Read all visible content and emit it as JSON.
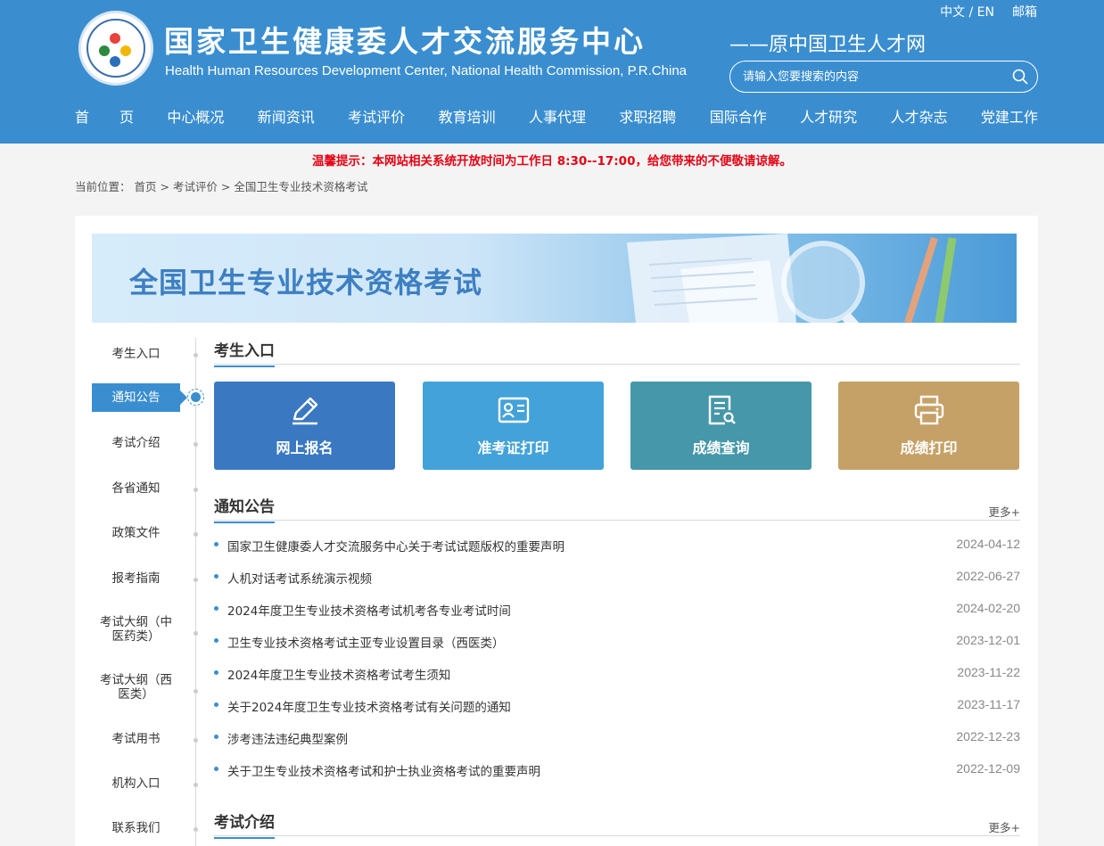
{
  "header": {
    "title": "国家卫生健康委人才交流服务中心",
    "subtitle": "Health Human Resources Development Center, National Health Commission, P.R.China",
    "slogan": "——原中国卫生人才网",
    "lang": "中文 / EN",
    "mail": "邮箱",
    "search_placeholder": "请输入您要搜索的内容"
  },
  "nav": [
    "首页",
    "中心概况",
    "新闻资讯",
    "考试评价",
    "教育培训",
    "人事代理",
    "求职招聘",
    "国际合作",
    "人才研究",
    "人才杂志",
    "党建工作"
  ],
  "notice": "温馨提示：本网站相关系统开放时间为工作日 8:30--17:00，给您带来的不便敬请谅解。",
  "breadcrumb": {
    "label": "当前位置：",
    "home": "首页",
    "sep1": " > ",
    "section": "考试评价",
    "sep2": " > ",
    "current": "全国卫生专业技术资格考试"
  },
  "banner": {
    "title": "全国卫生专业技术资格考试"
  },
  "sidebar": [
    "考生入口",
    "通知公告",
    "考试介绍",
    "各省通知",
    "政策文件",
    "报考指南",
    "考试大纲（中医药类）",
    "考试大纲（西医类）",
    "考试用书",
    "机构入口",
    "联系我们"
  ],
  "sections": {
    "entry": "考生入口",
    "notices": "通知公告",
    "intro": "考试介绍",
    "more": "更多+"
  },
  "tiles": [
    {
      "label": "网上报名",
      "icon": "pen-icon",
      "color": "#3a78c1"
    },
    {
      "label": "准考证打印",
      "icon": "id-card-icon",
      "color": "#43a2d9"
    },
    {
      "label": "成绩查询",
      "icon": "document-search-icon",
      "color": "#4597a9"
    },
    {
      "label": "成绩打印",
      "icon": "printer-icon",
      "color": "#c6a167"
    }
  ],
  "news": [
    {
      "title": "国家卫生健康委人才交流服务中心关于考试试题版权的重要声明",
      "date": "2024-04-12"
    },
    {
      "title": "人机对话考试系统演示视频",
      "date": "2022-06-27"
    },
    {
      "title": "2024年度卫生专业技术资格考试机考各专业考试时间",
      "date": "2024-02-20"
    },
    {
      "title": "卫生专业技术资格考试主亚专业设置目录（西医类）",
      "date": "2023-12-01"
    },
    {
      "title": "2024年度卫生专业技术资格考试考生须知",
      "date": "2023-11-22"
    },
    {
      "title": "关于2024年度卫生专业技术资格考试有关问题的通知",
      "date": "2023-11-17"
    },
    {
      "title": "涉考违法违纪典型案例",
      "date": "2022-12-23"
    },
    {
      "title": "关于卫生专业技术资格考试和护士执业资格考试的重要声明",
      "date": "2022-12-09"
    }
  ]
}
